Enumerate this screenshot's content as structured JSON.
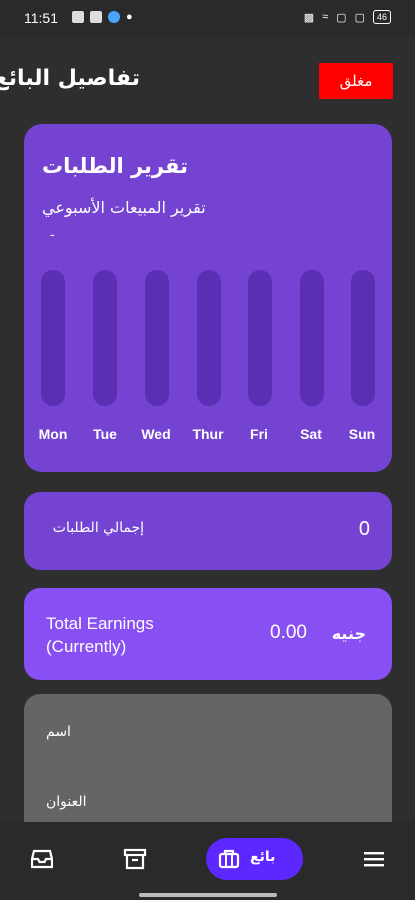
{
  "status_bar": {
    "time": "11:51",
    "battery": "46"
  },
  "header": {
    "title": "تفاصيل البائع",
    "close_label": "مغلق"
  },
  "report": {
    "title": "تقرير الطلبات",
    "subtitle": "تقرير المبيعات الأسبوعي",
    "dash": "-",
    "days": [
      "Mon",
      "Tue",
      "Wed",
      "Thur",
      "Fri",
      "Sat",
      "Sun"
    ],
    "values": [
      0,
      0,
      0,
      0,
      0,
      0,
      0
    ]
  },
  "orders": {
    "label": "إجمالي الطلبات",
    "value": "0"
  },
  "earnings": {
    "label": "Total Earnings (Currently)",
    "amount": "0.00",
    "currency": "جنيه"
  },
  "info": {
    "name_label": "اسم",
    "address_label": "العنوان"
  },
  "nav": {
    "seller_label": "بائع"
  },
  "colors": {
    "accent": "#7443d1",
    "earnings": "#884ff2",
    "close": "#ff0000",
    "nav_active": "#5d27ff"
  }
}
